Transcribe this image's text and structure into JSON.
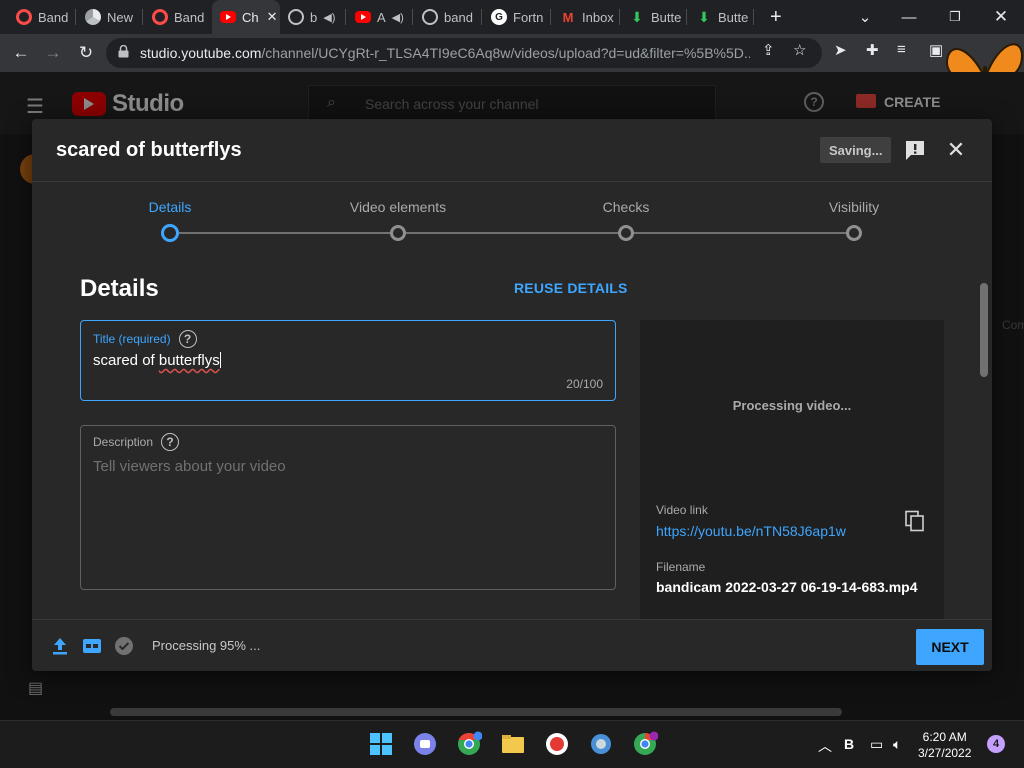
{
  "browser": {
    "tabs": [
      {
        "label": "Band",
        "icon": "record-icon",
        "active": false
      },
      {
        "label": "New",
        "icon": "chrome-icon",
        "active": false
      },
      {
        "label": "Band",
        "icon": "record-icon",
        "active": false
      },
      {
        "label": "Ch",
        "icon": "youtube-icon",
        "active": true
      },
      {
        "label": "b",
        "icon": "globe-icon",
        "active": false
      },
      {
        "label": "A",
        "icon": "youtube-icon",
        "active": false
      },
      {
        "label": "band",
        "icon": "globe-icon",
        "active": false
      },
      {
        "label": "Fortn",
        "icon": "g-icon",
        "active": false
      },
      {
        "label": "Inbox",
        "icon": "gmail-icon",
        "active": false
      },
      {
        "label": "Butte",
        "icon": "download-icon",
        "active": false
      },
      {
        "label": "Butte",
        "icon": "download-icon",
        "active": false
      }
    ],
    "new_tab": "+",
    "url_host": "studio.youtube.com",
    "url_path": "/channel/UCYgRt-r_TLSA4TI9eC6Aq8w/videos/upload?d=ud&filter=%5B%5D..."
  },
  "studio": {
    "logo_text": "Studio",
    "search_placeholder": "Search across your channel",
    "create_label": "CREATE",
    "side_text": "Com"
  },
  "dialog": {
    "title": "scared of butterflys",
    "saving_label": "Saving...",
    "steps": [
      {
        "label": "Details",
        "active": true
      },
      {
        "label": "Video elements",
        "active": false
      },
      {
        "label": "Checks",
        "active": false
      },
      {
        "label": "Visibility",
        "active": false
      }
    ],
    "details_heading": "Details",
    "reuse_label": "REUSE DETAILS",
    "title_field": {
      "label": "Title (required)",
      "value_prefix": "scared of ",
      "value_flagged": "butterflys",
      "count": "20/100"
    },
    "description_field": {
      "label": "Description",
      "placeholder": "Tell viewers about your video"
    },
    "preview": {
      "status": "Processing video...",
      "video_link_label": "Video link",
      "video_link": "https://youtu.be/nTN58J6ap1w",
      "filename_label": "Filename",
      "filename": "bandicam 2022-03-27 06-19-14-683.mp4"
    },
    "footer": {
      "status": "Processing 95% ...",
      "next_label": "NEXT"
    }
  },
  "taskbar": {
    "time": "6:20 AM",
    "date": "3/27/2022",
    "notifications": "4"
  },
  "colors": {
    "accent": "#3ea6ff",
    "dialog_bg": "#282828",
    "youtube_red": "#ff0000"
  }
}
